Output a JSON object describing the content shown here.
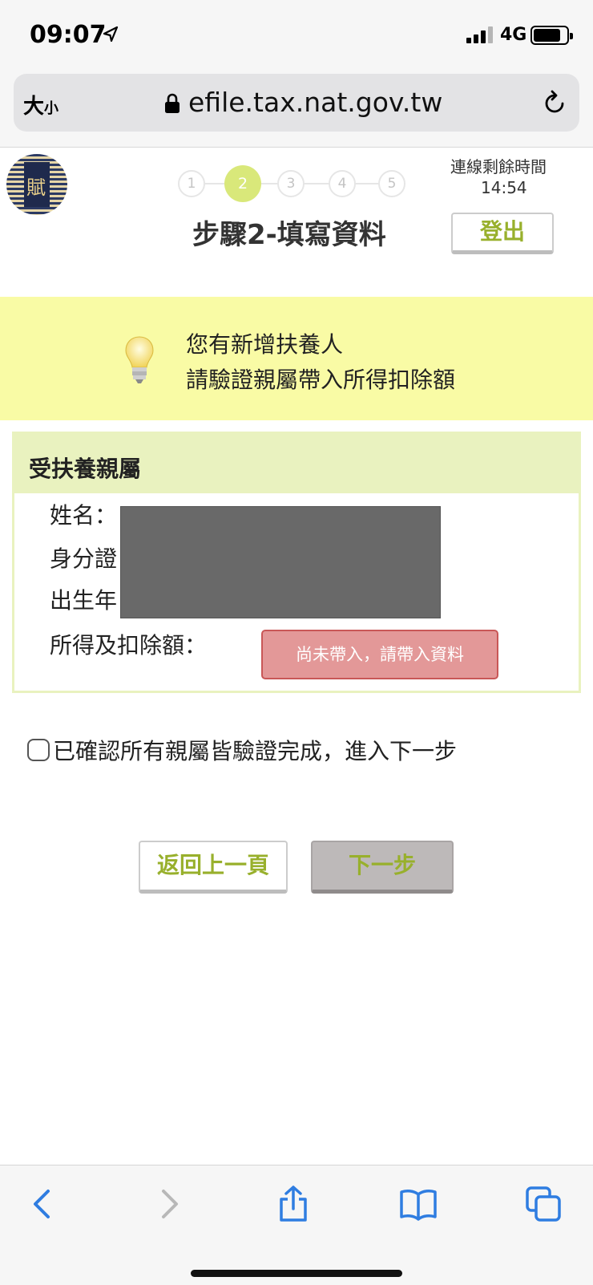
{
  "status_bar": {
    "time": "09:07",
    "network": "4G"
  },
  "browser": {
    "text_size_label": "大",
    "text_size_small": "小",
    "url": "efile.tax.nat.gov.tw"
  },
  "logo": {
    "glyph": "賦"
  },
  "steps": {
    "items": [
      "1",
      "2",
      "3",
      "4",
      "5"
    ],
    "current": 2,
    "title": "步驟2-填寫資料"
  },
  "session": {
    "label": "連線剩餘時間",
    "remaining": "14:54"
  },
  "header": {
    "logout_label": "登出"
  },
  "notice": {
    "line1": "您有新增扶養人",
    "line2": "請驗證親屬帶入所得扣除額"
  },
  "dependents": {
    "title": "受扶養親屬",
    "name_label": "姓名：",
    "id_label": "身分證",
    "birth_label": "出生年",
    "income_label": "所得及扣除額：",
    "income_status": "尚未帶入，請帶入資料"
  },
  "confirm": {
    "label": "已確認所有親屬皆驗證完成，進入下一步",
    "checked": false
  },
  "buttons": {
    "back": "返回上一頁",
    "next": "下一步"
  },
  "colors": {
    "accent": "#98b02c",
    "notice_bg": "#f9fba5",
    "panel_bg": "#e9f2bf",
    "warning_btn": "#e39898",
    "active_step": "#d9e87a",
    "ios_blue": "#2f7de1"
  },
  "toolbar": {
    "icons": [
      "back-arrow-icon",
      "forward-arrow-icon",
      "share-icon",
      "bookmarks-icon",
      "tabs-icon"
    ]
  }
}
